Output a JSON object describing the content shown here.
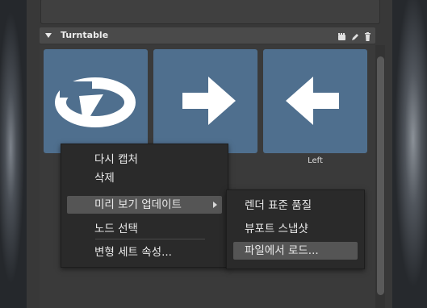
{
  "section": {
    "title": "Turntable",
    "icons": [
      "camera-icon",
      "pencil-icon",
      "trash-icon"
    ]
  },
  "thumbnails": [
    {
      "label": "",
      "icon": "rotate-icon"
    },
    {
      "label": "",
      "icon": "arrow-right-icon"
    },
    {
      "label": "Left",
      "icon": "arrow-left-icon"
    }
  ],
  "context_menu": {
    "items": [
      {
        "label": "다시 캡처"
      },
      {
        "label": "삭제"
      },
      {
        "label": "미리 보기 업데이트",
        "has_submenu": true
      },
      {
        "label": "노드 선택"
      },
      {
        "label": "변형 세트 속성..."
      }
    ]
  },
  "submenu": {
    "items": [
      {
        "label": "렌더 표준 품질"
      },
      {
        "label": "뷰포트 스냅샷"
      },
      {
        "label": "파일에서 로드..."
      }
    ]
  },
  "colors": {
    "thumb_bg": "#4f6f8e",
    "menu_bg": "#2a2a2a",
    "highlight": "#555555"
  }
}
